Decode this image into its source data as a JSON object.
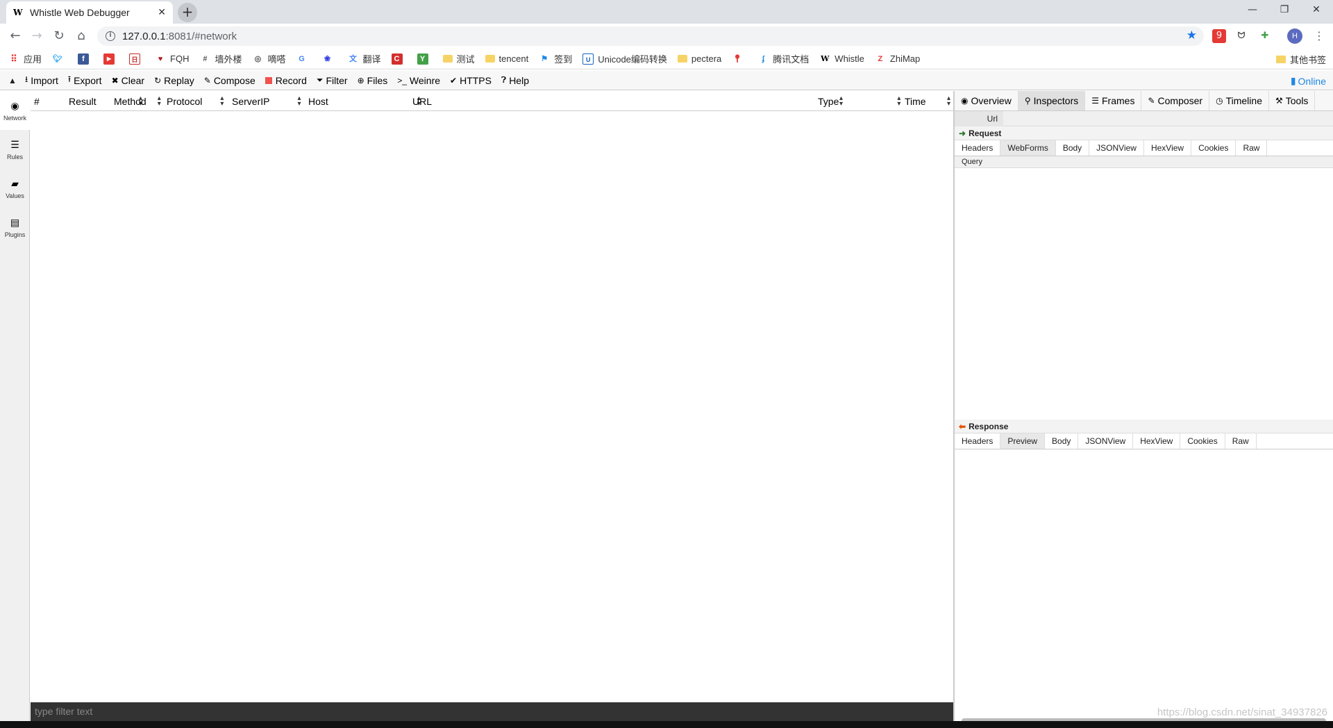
{
  "browser": {
    "tab_title": "Whistle Web Debugger",
    "tab_favicon": "W",
    "url_host": "127.0.0.1",
    "url_rest": ":8081/#network",
    "profile_initial": "H"
  },
  "bookmarks": [
    {
      "label": "应用",
      "icon": "apps-grid-icon"
    },
    {
      "label": "",
      "icon": "twitter-icon"
    },
    {
      "label": "",
      "icon": "facebook-icon"
    },
    {
      "label": "",
      "icon": "youtube-icon"
    },
    {
      "label": "",
      "icon": "calendar-icon"
    },
    {
      "label": "FQH",
      "icon": "heart-icon"
    },
    {
      "label": "墙外楼",
      "icon": "grid-icon"
    },
    {
      "label": "嘀嗒",
      "icon": "globe-icon"
    },
    {
      "label": "",
      "icon": "google-icon"
    },
    {
      "label": "",
      "icon": "baidu-icon"
    },
    {
      "label": "翻译",
      "icon": "translate-icon"
    },
    {
      "label": "",
      "icon": "c-icon"
    },
    {
      "label": "",
      "icon": "y-icon"
    },
    {
      "label": "测试",
      "icon": "folder-icon"
    },
    {
      "label": "tencent",
      "icon": "folder-icon"
    },
    {
      "label": "签到",
      "icon": "sign-icon"
    },
    {
      "label": "Unicode编码转换",
      "icon": "unicode-icon"
    },
    {
      "label": "pectera",
      "icon": "folder-icon"
    },
    {
      "label": "",
      "icon": "map-pin-icon"
    },
    {
      "label": "腾讯文档",
      "icon": "tencent-docs-icon"
    },
    {
      "label": "Whistle",
      "icon": "whistle-icon"
    },
    {
      "label": "ZhiMap",
      "icon": "zhimap-icon"
    }
  ],
  "bookmarks_other": "其他书签",
  "toolbar": {
    "import": "Import",
    "export": "Export",
    "clear": "Clear",
    "replay": "Replay",
    "compose": "Compose",
    "record": "Record",
    "filter": "Filter",
    "files": "Files",
    "weinre": "Weinre",
    "https": "HTTPS",
    "help": "Help",
    "online": "Online"
  },
  "sidebar": {
    "items": [
      {
        "label": "Network",
        "active": true
      },
      {
        "label": "Rules",
        "active": false
      },
      {
        "label": "Values",
        "active": false
      },
      {
        "label": "Plugins",
        "active": false
      }
    ]
  },
  "network": {
    "columns": [
      "#",
      "Result",
      "Method",
      "Protocol",
      "ServerIP",
      "Host",
      "URL",
      "Type",
      "Time"
    ],
    "filter_placeholder": "type filter text"
  },
  "detail": {
    "tabs": [
      "Overview",
      "Inspectors",
      "Frames",
      "Composer",
      "Timeline",
      "Tools"
    ],
    "active_tab": "Inspectors",
    "url_label": "Url",
    "request_label": "Request",
    "request_tabs": [
      "Headers",
      "WebForms",
      "Body",
      "JSONView",
      "HexView",
      "Cookies",
      "Raw"
    ],
    "request_active": "WebForms",
    "query_label": "Query",
    "response_label": "Response",
    "response_tabs": [
      "Headers",
      "Preview",
      "Body",
      "JSONView",
      "HexView",
      "Cookies",
      "Raw"
    ],
    "response_active": "Preview"
  },
  "watermark": "https://blog.csdn.net/sinat_34937826",
  "colors": {
    "record": "#ef5350",
    "online": "#1e88e5",
    "request_arrow": "#2e7d32",
    "response_arrow": "#e65100",
    "filter_bar": "#333333"
  }
}
